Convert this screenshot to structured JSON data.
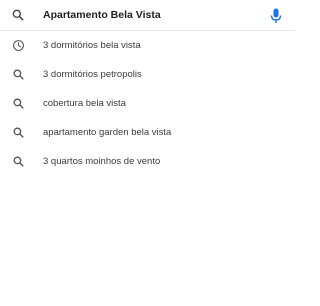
{
  "search": {
    "query": "Apartamento Bela Vista",
    "leading_icon": "search-icon",
    "trailing_icon": "mic-icon",
    "mic_color": "#1a73e8"
  },
  "suggestions": [
    {
      "icon": "history-icon",
      "label": "3 dormitórios bela vista"
    },
    {
      "icon": "search-icon",
      "label": "3 dormitórios petropolis"
    },
    {
      "icon": "search-icon",
      "label": "cobertura bela vista"
    },
    {
      "icon": "search-icon",
      "label": "apartamento garden bela vista"
    },
    {
      "icon": "search-icon",
      "label": "3 quartos moinhos de vento"
    }
  ]
}
